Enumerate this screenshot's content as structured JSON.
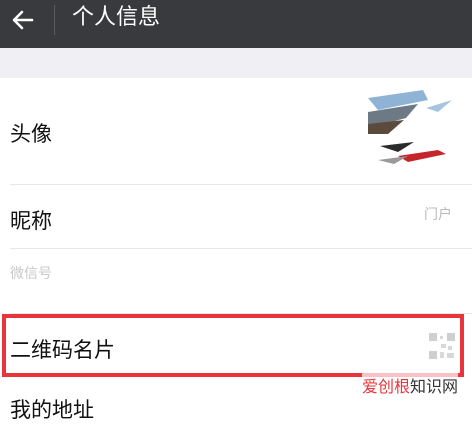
{
  "header": {
    "title": "个人信息",
    "back_icon": "arrow-left-icon"
  },
  "rows": {
    "avatar_label": "头像",
    "nickname_label": "昵称",
    "nickname_value": "门户",
    "wechat_id_label": "微信号",
    "qrcode_label": "二维码名片",
    "address_label": "我的地址"
  },
  "colors": {
    "header_bg": "#393a3e",
    "highlight_border": "#e8343a",
    "page_gap": "#efeff4"
  },
  "watermark": {
    "brand": "爱创根",
    "suffix": "知识网"
  }
}
